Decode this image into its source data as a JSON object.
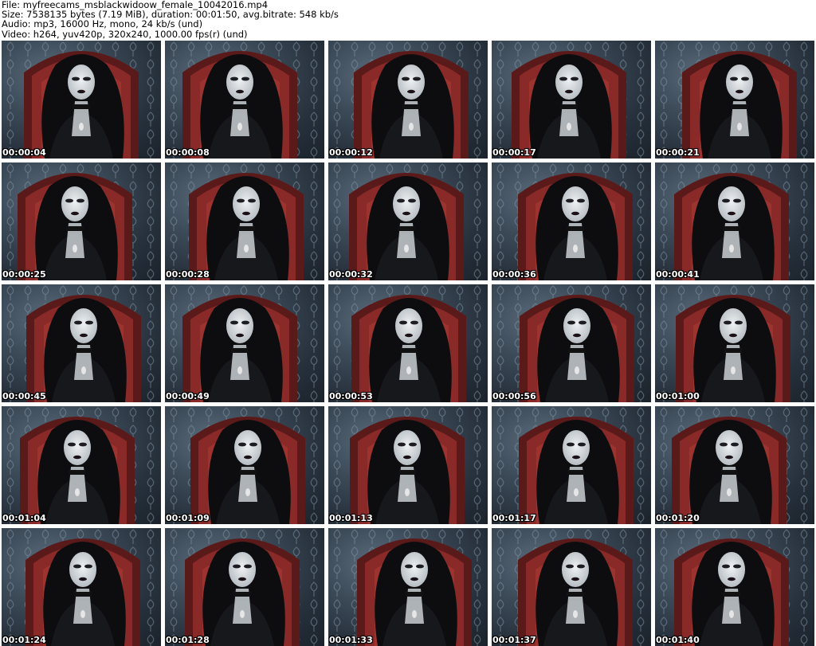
{
  "header": {
    "file_line": "File: myfreecams_msblackwidoow_female_10042016.mp4",
    "size_line": "Size: 7538135 bytes (7.19 MiB), duration: 00:01:50, avg.bitrate: 548 kb/s",
    "audio_line": "Audio: mp3, 16000 Hz, mono, 24 kb/s (und)",
    "video_line": "Video: h264, yuv420p, 320x240, 1000.00 fps(r) (und)"
  },
  "thumbnails": [
    {
      "timestamp": "00:00:04"
    },
    {
      "timestamp": "00:00:08"
    },
    {
      "timestamp": "00:00:12"
    },
    {
      "timestamp": "00:00:17"
    },
    {
      "timestamp": "00:00:21"
    },
    {
      "timestamp": "00:00:25"
    },
    {
      "timestamp": "00:00:28"
    },
    {
      "timestamp": "00:00:32"
    },
    {
      "timestamp": "00:00:36"
    },
    {
      "timestamp": "00:00:41"
    },
    {
      "timestamp": "00:00:45"
    },
    {
      "timestamp": "00:00:49"
    },
    {
      "timestamp": "00:00:53"
    },
    {
      "timestamp": "00:00:56"
    },
    {
      "timestamp": "00:01:00"
    },
    {
      "timestamp": "00:01:04"
    },
    {
      "timestamp": "00:01:09"
    },
    {
      "timestamp": "00:01:13"
    },
    {
      "timestamp": "00:01:17"
    },
    {
      "timestamp": "00:01:20"
    },
    {
      "timestamp": "00:01:24"
    },
    {
      "timestamp": "00:01:28"
    },
    {
      "timestamp": "00:01:33"
    },
    {
      "timestamp": "00:01:37"
    },
    {
      "timestamp": "00:01:40"
    }
  ],
  "colors": {
    "wallpaper": "#3c4a58",
    "chair": "#8a2a28",
    "hair": "#0d0d10",
    "skin": "#d9dde0",
    "timestamp_text": "#ffffff"
  }
}
